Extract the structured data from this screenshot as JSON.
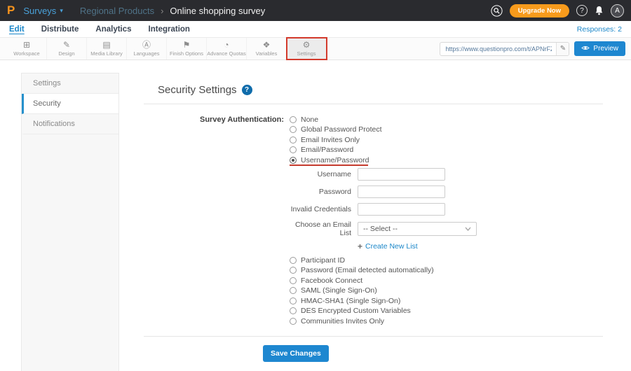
{
  "colors": {
    "accent": "#1b87c9",
    "brand_orange": "#f7941e",
    "annotation_red": "#d33a2c",
    "topbar_bg": "#2a2b2f"
  },
  "topbar": {
    "logo_letter": "P",
    "product": "Surveys",
    "caret": "▾",
    "breadcrumb_parent": "Regional Products",
    "breadcrumb_sep": "›",
    "breadcrumb_current": "Online shopping survey",
    "upgrade_label": "Upgrade Now",
    "help_label": "?",
    "avatar_letter": "A"
  },
  "nav": {
    "tabs": [
      {
        "label": "Edit"
      },
      {
        "label": "Distribute"
      },
      {
        "label": "Analytics"
      },
      {
        "label": "Integration"
      }
    ],
    "responses_label": "Responses: 2"
  },
  "toolbar": {
    "items": [
      {
        "label": "Workspace",
        "glyph": "⊞"
      },
      {
        "label": "Design",
        "glyph": "✎"
      },
      {
        "label": "Media Library",
        "glyph": "▤"
      },
      {
        "label": "Languages",
        "glyph": "Ⓐ"
      },
      {
        "label": "Finish Options",
        "glyph": "⚑"
      },
      {
        "label": "Advance Quotas",
        "glyph": "◔"
      },
      {
        "label": "Variables",
        "glyph": "❖"
      },
      {
        "label": "Settings",
        "glyph": "⚙"
      }
    ],
    "active_item": "Settings",
    "url_value": "https://www.questionpro.com/t/APNrFZ",
    "edit_glyph": "✎",
    "preview_label": "Preview"
  },
  "sidebar": {
    "items": [
      {
        "label": "Settings"
      },
      {
        "label": "Security"
      },
      {
        "label": "Notifications"
      }
    ],
    "active_item": "Security"
  },
  "main": {
    "title": "Security Settings",
    "help_badge": "?",
    "auth_label": "Survey Authentication:",
    "auth_options_top": [
      {
        "label": "None"
      },
      {
        "label": "Global Password Protect"
      },
      {
        "label": "Email Invites Only"
      },
      {
        "label": "Email/Password"
      },
      {
        "label": "Username/Password"
      }
    ],
    "selected_option": "Username/Password",
    "fields": [
      {
        "label": "Username",
        "value": ""
      },
      {
        "label": "Password",
        "value": ""
      },
      {
        "label": "Invalid Credentials",
        "value": ""
      }
    ],
    "email_list": {
      "label": "Choose an Email List",
      "selected_value": "-- Select --"
    },
    "create_list": {
      "plus": "+",
      "label": "Create New List"
    },
    "auth_options_bottom": [
      {
        "label": "Participant ID"
      },
      {
        "label": "Password (Email detected automatically)"
      },
      {
        "label": "Facebook Connect"
      },
      {
        "label": "SAML (Single Sign-On)"
      },
      {
        "label": "HMAC-SHA1 (Single Sign-On)"
      },
      {
        "label": "DES Encrypted Custom Variables"
      },
      {
        "label": "Communities Invites Only"
      }
    ],
    "save_label": "Save Changes"
  }
}
